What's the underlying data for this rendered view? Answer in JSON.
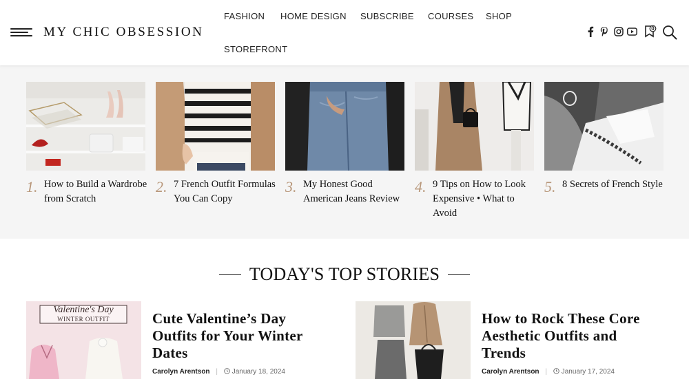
{
  "brand": {
    "name": "MY CHIC OBSESSION"
  },
  "nav": {
    "items": [
      "FASHION",
      "HOME DESIGN",
      "SUBSCRIBE",
      "COURSES",
      "SHOP",
      "STOREFRONT"
    ]
  },
  "header_icons": [
    "facebook-icon",
    "pinterest-icon",
    "instagram-icon",
    "youtube-icon",
    "bookmark-icon",
    "search-icon"
  ],
  "bookmark_count": "0",
  "popular": [
    {
      "num": "1.",
      "title": "How to Build a Wardrobe from Scratch"
    },
    {
      "num": "2.",
      "title": "7 French Outfit Formulas You Can Copy"
    },
    {
      "num": "3.",
      "title": "My Honest Good American Jeans Review"
    },
    {
      "num": "4.",
      "title": "9 Tips on How to Look Expensive • What to Avoid"
    },
    {
      "num": "5.",
      "title": "8 Secrets of French Style"
    }
  ],
  "top_stories": {
    "heading": "TODAY'S TOP STORIES",
    "items": [
      {
        "title": "Cute Valentine’s Day Outfits for Your Winter Dates",
        "author": "Carolyn Arentson",
        "date": "January 18, 2024",
        "thumb_text_1": "Valentine's Day",
        "thumb_text_2": "WINTER OUTFIT"
      },
      {
        "title": "How to Rock These Core Aesthetic Outfits and Trends",
        "author": "Carolyn Arentson",
        "date": "January 17, 2024"
      }
    ]
  },
  "colors": {
    "accent": "#b8977a",
    "strip_bg": "#f5f5f5",
    "text": "#111111"
  }
}
